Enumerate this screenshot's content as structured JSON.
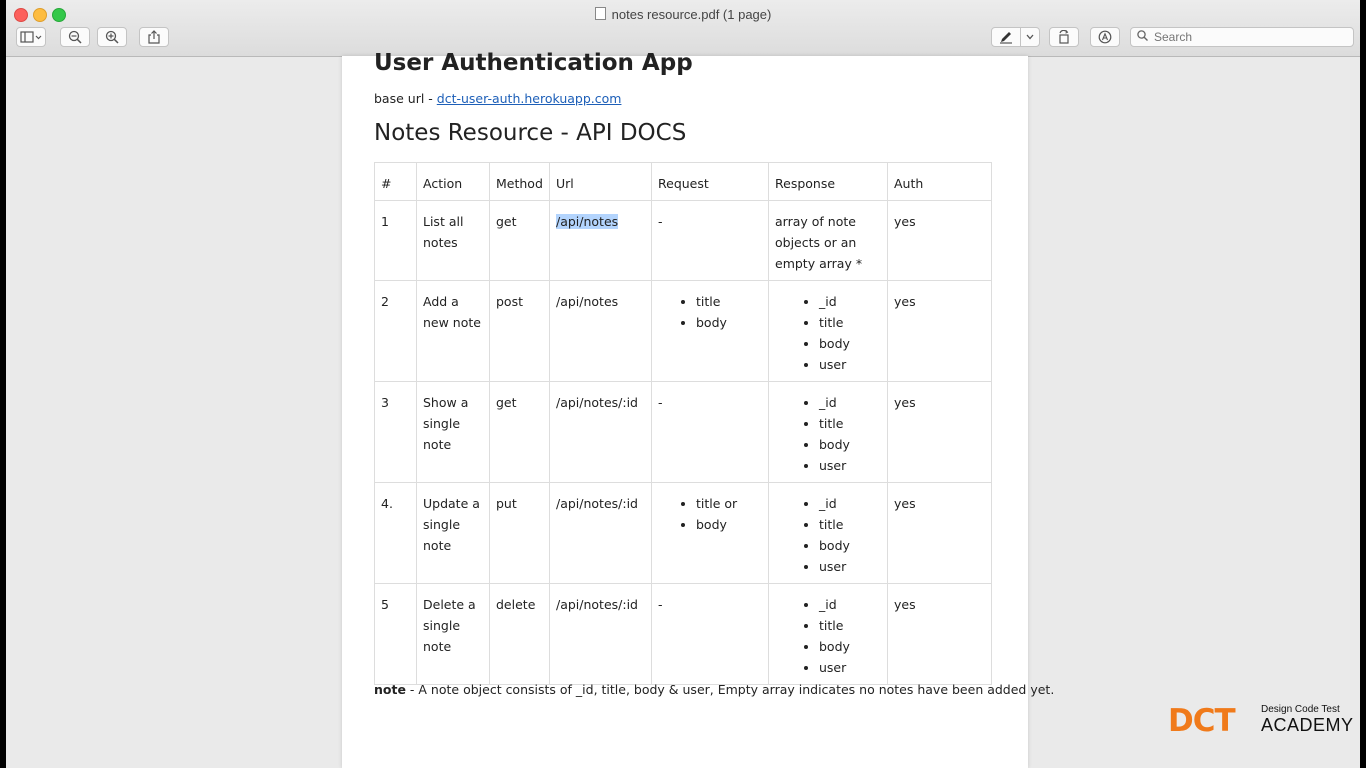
{
  "window": {
    "title": "notes resource.pdf (1 page)"
  },
  "toolbar": {
    "sidebar_icon": "sidebar-icon",
    "zoom_out_icon": "zoom-out-icon",
    "zoom_in_icon": "zoom-in-icon",
    "share_icon": "share-icon",
    "markup_icon": "pen-icon",
    "rotate_icon": "rotate-icon",
    "annotate_icon": "annotate-icon",
    "search_placeholder": "Search"
  },
  "doc": {
    "title": "User Authentication App",
    "base_url_label": "base url - ",
    "base_url_link": "dct-user-auth.herokuapp.com",
    "subtitle": "Notes Resource - API DOCS",
    "table": {
      "headers": [
        "#",
        "Action",
        "Method",
        "Url",
        "Request",
        "Response",
        "Auth"
      ],
      "rows": [
        {
          "num": "1",
          "action": "List all notes",
          "method": "get",
          "url": "/api/notes",
          "request": "-",
          "request_list": [],
          "response": "array of note objects  or an empty array *",
          "response_list": [],
          "auth": "yes"
        },
        {
          "num": "2",
          "action": "Add a new note",
          "method": "post",
          "url": "/api/notes",
          "request": "",
          "request_list": [
            "title",
            "body"
          ],
          "response": "",
          "response_list": [
            "_id",
            "title",
            "body",
            "user"
          ],
          "auth": "yes"
        },
        {
          "num": "3",
          "action": "Show a single note",
          "method": "get",
          "url": "/api/notes/:id",
          "request": "-",
          "request_list": [],
          "response": "",
          "response_list": [
            "_id",
            "title",
            "body",
            "user"
          ],
          "auth": "yes"
        },
        {
          "num": "4.",
          "action": "Update a single note",
          "method": "put",
          "url": "/api/notes/:id",
          "request": "",
          "request_list": [
            "title or",
            "body"
          ],
          "response": "",
          "response_list": [
            "_id",
            "title",
            "body",
            "user"
          ],
          "auth": "yes"
        },
        {
          "num": "5",
          "action": "Delete a single note",
          "method": "delete",
          "url": "/api/notes/:id",
          "request": "-",
          "request_list": [],
          "response": "",
          "response_list": [
            "_id",
            "title",
            "body",
            "user"
          ],
          "auth": "yes"
        }
      ]
    },
    "note_label": "note",
    "note_text": " - A note object consists of _id, title, body & user, Empty array indicates no notes have been added yet."
  },
  "watermark": {
    "logo_text": "DCT",
    "tagline": "Design Code Test",
    "academy": "ACADEMY"
  },
  "colors": {
    "link": "#1d5fb8",
    "selection": "#b3d4fd",
    "logo_orange": "#f07a1a"
  }
}
